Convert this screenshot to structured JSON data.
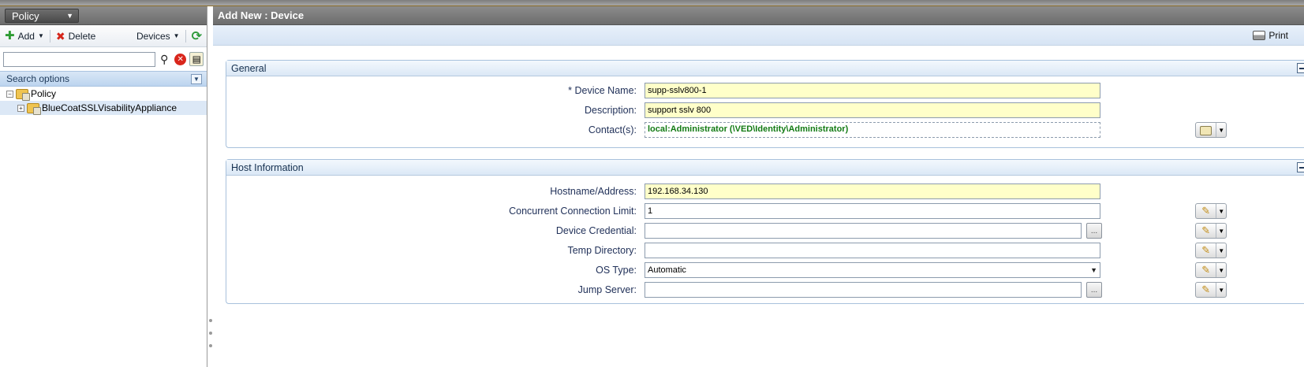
{
  "left_pane": {
    "selector_label": "Policy",
    "toolbar": {
      "add_label": "Add",
      "delete_label": "Delete",
      "devices_label": "Devices"
    },
    "search": {
      "value": "",
      "options_label": "Search options"
    },
    "tree": [
      {
        "label": "Policy",
        "expander": "−",
        "level": 0,
        "selected": false
      },
      {
        "label": "BlueCoatSSLVisabilityAppliance",
        "expander": "+",
        "level": 1,
        "selected": true
      }
    ]
  },
  "right_pane": {
    "title": "Add New : Device",
    "print_label": "Print",
    "general": {
      "title": "General",
      "device_name_label": "* Device Name:",
      "device_name_value": "supp-sslv800-1",
      "description_label": "Description:",
      "description_value": "support sslv 800",
      "contacts_label": "Contact(s):",
      "contacts_value": "local:Administrator (\\VED\\Identity\\Administrator)"
    },
    "host": {
      "title": "Host Information",
      "hostname_label": "Hostname/Address:",
      "hostname_value": "192.168.34.130",
      "conn_limit_label": "Concurrent Connection Limit:",
      "conn_limit_value": "1",
      "credential_label": "Device Credential:",
      "credential_value": "",
      "temp_dir_label": "Temp Directory:",
      "temp_dir_value": "",
      "os_type_label": "OS Type:",
      "os_type_value": "Automatic",
      "jump_server_label": "Jump Server:",
      "jump_server_value": "",
      "browse_label": "..."
    }
  },
  "colors": {
    "header_gray": "#7a7a7a",
    "required_field": "#ffffc9",
    "panel_border": "#a8c1dc",
    "label_text": "#22325a",
    "contact_text": "#137b14"
  },
  "icons": [
    "plus-icon",
    "delete-x-icon",
    "refresh-icon",
    "magnifier-icon",
    "clear-icon",
    "certificate-icon",
    "folder-icon",
    "print-icon",
    "pencil-icon",
    "contact-card-icon"
  ]
}
